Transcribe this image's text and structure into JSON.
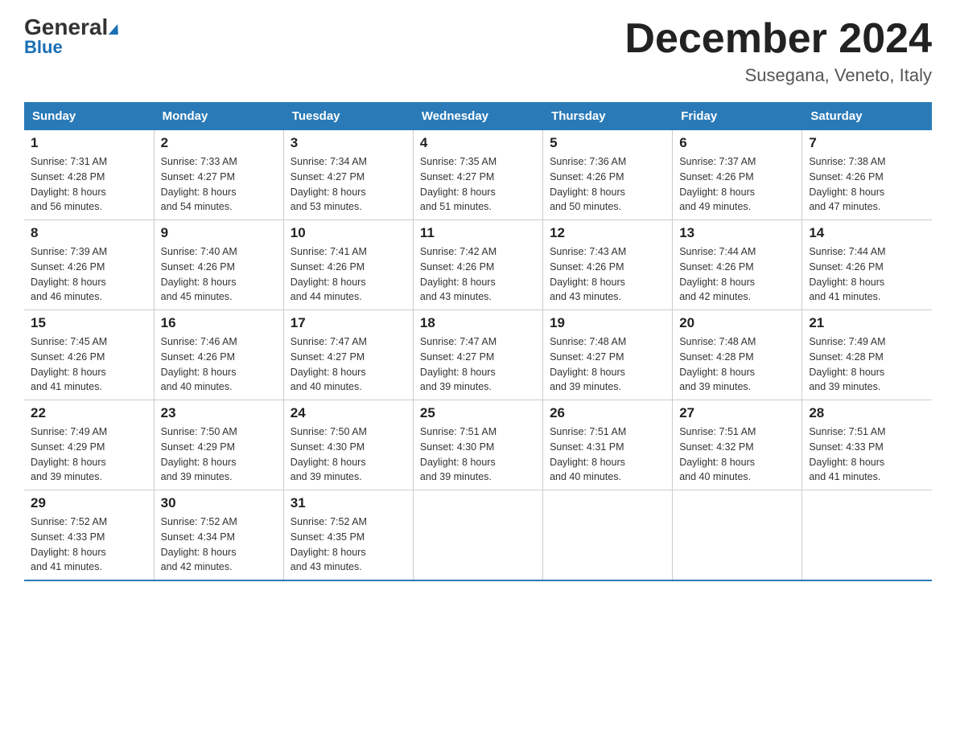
{
  "header": {
    "logo_general": "General",
    "logo_blue": "Blue",
    "month_title": "December 2024",
    "location": "Susegana, Veneto, Italy"
  },
  "days_of_week": [
    "Sunday",
    "Monday",
    "Tuesday",
    "Wednesday",
    "Thursday",
    "Friday",
    "Saturday"
  ],
  "weeks": [
    [
      {
        "day": "1",
        "sunrise": "7:31 AM",
        "sunset": "4:28 PM",
        "daylight": "8 hours and 56 minutes."
      },
      {
        "day": "2",
        "sunrise": "7:33 AM",
        "sunset": "4:27 PM",
        "daylight": "8 hours and 54 minutes."
      },
      {
        "day": "3",
        "sunrise": "7:34 AM",
        "sunset": "4:27 PM",
        "daylight": "8 hours and 53 minutes."
      },
      {
        "day": "4",
        "sunrise": "7:35 AM",
        "sunset": "4:27 PM",
        "daylight": "8 hours and 51 minutes."
      },
      {
        "day": "5",
        "sunrise": "7:36 AM",
        "sunset": "4:26 PM",
        "daylight": "8 hours and 50 minutes."
      },
      {
        "day": "6",
        "sunrise": "7:37 AM",
        "sunset": "4:26 PM",
        "daylight": "8 hours and 49 minutes."
      },
      {
        "day": "7",
        "sunrise": "7:38 AM",
        "sunset": "4:26 PM",
        "daylight": "8 hours and 47 minutes."
      }
    ],
    [
      {
        "day": "8",
        "sunrise": "7:39 AM",
        "sunset": "4:26 PM",
        "daylight": "8 hours and 46 minutes."
      },
      {
        "day": "9",
        "sunrise": "7:40 AM",
        "sunset": "4:26 PM",
        "daylight": "8 hours and 45 minutes."
      },
      {
        "day": "10",
        "sunrise": "7:41 AM",
        "sunset": "4:26 PM",
        "daylight": "8 hours and 44 minutes."
      },
      {
        "day": "11",
        "sunrise": "7:42 AM",
        "sunset": "4:26 PM",
        "daylight": "8 hours and 43 minutes."
      },
      {
        "day": "12",
        "sunrise": "7:43 AM",
        "sunset": "4:26 PM",
        "daylight": "8 hours and 43 minutes."
      },
      {
        "day": "13",
        "sunrise": "7:44 AM",
        "sunset": "4:26 PM",
        "daylight": "8 hours and 42 minutes."
      },
      {
        "day": "14",
        "sunrise": "7:44 AM",
        "sunset": "4:26 PM",
        "daylight": "8 hours and 41 minutes."
      }
    ],
    [
      {
        "day": "15",
        "sunrise": "7:45 AM",
        "sunset": "4:26 PM",
        "daylight": "8 hours and 41 minutes."
      },
      {
        "day": "16",
        "sunrise": "7:46 AM",
        "sunset": "4:26 PM",
        "daylight": "8 hours and 40 minutes."
      },
      {
        "day": "17",
        "sunrise": "7:47 AM",
        "sunset": "4:27 PM",
        "daylight": "8 hours and 40 minutes."
      },
      {
        "day": "18",
        "sunrise": "7:47 AM",
        "sunset": "4:27 PM",
        "daylight": "8 hours and 39 minutes."
      },
      {
        "day": "19",
        "sunrise": "7:48 AM",
        "sunset": "4:27 PM",
        "daylight": "8 hours and 39 minutes."
      },
      {
        "day": "20",
        "sunrise": "7:48 AM",
        "sunset": "4:28 PM",
        "daylight": "8 hours and 39 minutes."
      },
      {
        "day": "21",
        "sunrise": "7:49 AM",
        "sunset": "4:28 PM",
        "daylight": "8 hours and 39 minutes."
      }
    ],
    [
      {
        "day": "22",
        "sunrise": "7:49 AM",
        "sunset": "4:29 PM",
        "daylight": "8 hours and 39 minutes."
      },
      {
        "day": "23",
        "sunrise": "7:50 AM",
        "sunset": "4:29 PM",
        "daylight": "8 hours and 39 minutes."
      },
      {
        "day": "24",
        "sunrise": "7:50 AM",
        "sunset": "4:30 PM",
        "daylight": "8 hours and 39 minutes."
      },
      {
        "day": "25",
        "sunrise": "7:51 AM",
        "sunset": "4:30 PM",
        "daylight": "8 hours and 39 minutes."
      },
      {
        "day": "26",
        "sunrise": "7:51 AM",
        "sunset": "4:31 PM",
        "daylight": "8 hours and 40 minutes."
      },
      {
        "day": "27",
        "sunrise": "7:51 AM",
        "sunset": "4:32 PM",
        "daylight": "8 hours and 40 minutes."
      },
      {
        "day": "28",
        "sunrise": "7:51 AM",
        "sunset": "4:33 PM",
        "daylight": "8 hours and 41 minutes."
      }
    ],
    [
      {
        "day": "29",
        "sunrise": "7:52 AM",
        "sunset": "4:33 PM",
        "daylight": "8 hours and 41 minutes."
      },
      {
        "day": "30",
        "sunrise": "7:52 AM",
        "sunset": "4:34 PM",
        "daylight": "8 hours and 42 minutes."
      },
      {
        "day": "31",
        "sunrise": "7:52 AM",
        "sunset": "4:35 PM",
        "daylight": "8 hours and 43 minutes."
      },
      null,
      null,
      null,
      null
    ]
  ],
  "labels": {
    "sunrise": "Sunrise:",
    "sunset": "Sunset:",
    "daylight": "Daylight:"
  }
}
